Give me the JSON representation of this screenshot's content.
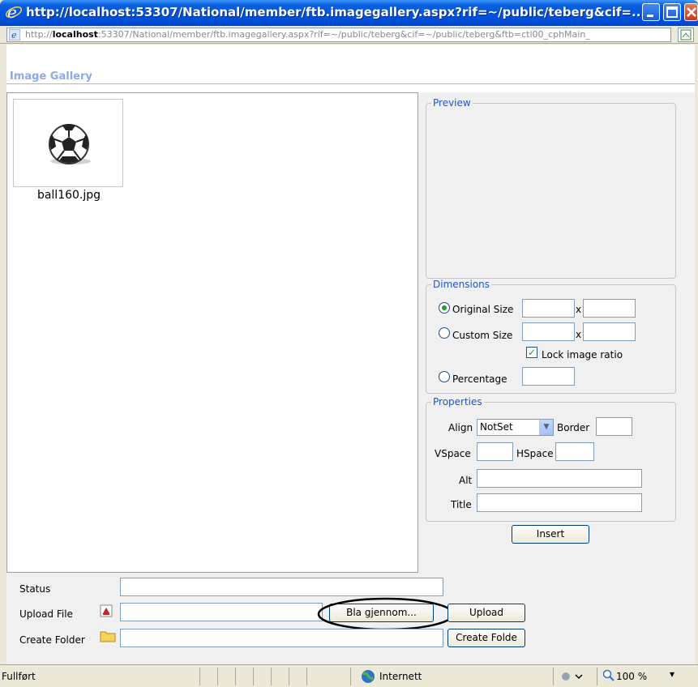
{
  "window": {
    "title": "http://localhost:53307/National/member/ftb.imagegallery.aspx?rif=~/public/teberg&cif=...",
    "address_prefix": "http://",
    "address_host": "localhost",
    "address_rest": ":53307/National/member/ftb.imagegallery.aspx?rif=~/public/teberg&cif=~/public/teberg&ftb=ctl00_cphMain_"
  },
  "gallery": {
    "title": "Image Gallery",
    "files": [
      {
        "name": "ball160.jpg"
      }
    ]
  },
  "preview": {
    "legend": "Preview"
  },
  "dimensions": {
    "legend": "Dimensions",
    "original_size_label": "Original Size",
    "custom_size_label": "Custom Size",
    "x_sep": "x",
    "lock_ratio_label": "Lock image ratio",
    "percentage_label": "Percentage",
    "selected": "original",
    "lock_ratio_checked": true
  },
  "properties": {
    "legend": "Properties",
    "align_label": "Align",
    "align_value": "NotSet",
    "border_label": "Border",
    "vspace_label": "VSpace",
    "hspace_label": "HSpace",
    "alt_label": "Alt",
    "title_label": "Title"
  },
  "actions": {
    "insert_label": "Insert",
    "status_label": "Status",
    "upload_file_label": "Upload File",
    "browse_label": "Bla gjennom...",
    "upload_label": "Upload",
    "create_folder_label": "Create Folder",
    "create_folder_button_label": "Create Folde"
  },
  "statusbar": {
    "status_text": "Fullført",
    "zone_text": "Internett",
    "zoom_text": "100 %"
  },
  "colors": {
    "titlebar": "#0054e3",
    "legend_text": "#1f55c8",
    "gallery_title": "#8fa8e6"
  }
}
